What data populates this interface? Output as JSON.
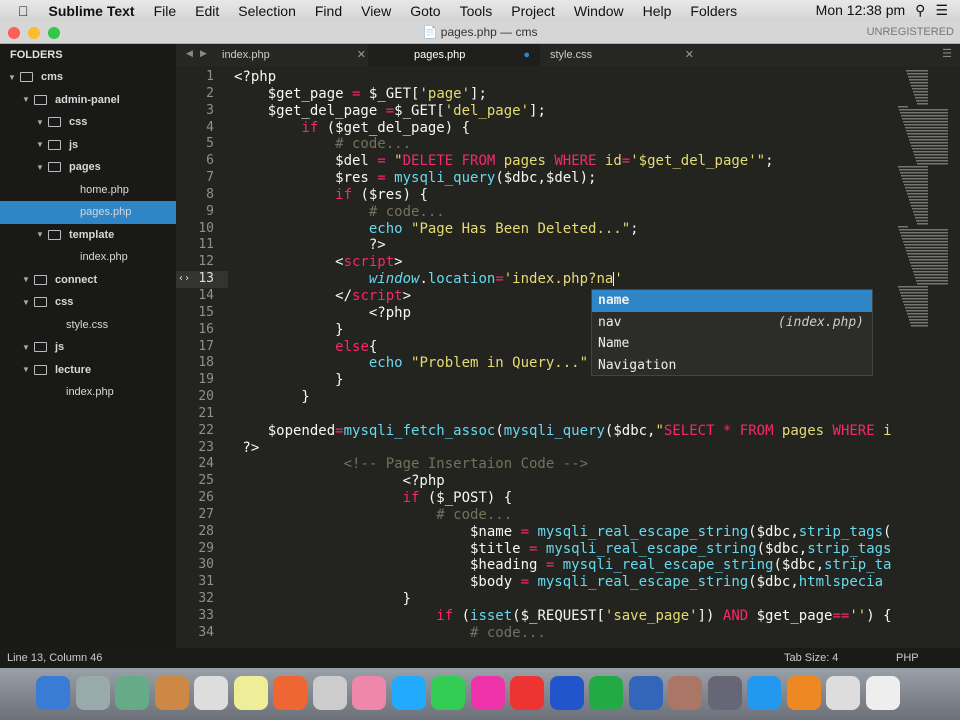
{
  "menubar": {
    "app": "Sublime Text",
    "items": [
      "File",
      "Edit",
      "Selection",
      "Find",
      "View",
      "Goto",
      "Tools",
      "Project",
      "Window",
      "Help",
      "Folders"
    ],
    "clock": "Mon 12:38 pm"
  },
  "window": {
    "title": "pages.php — cms",
    "unregistered": "UNREGISTERED"
  },
  "sidebar": {
    "header": "FOLDERS",
    "items": [
      {
        "label": "cms",
        "type": "folder",
        "depth": 0
      },
      {
        "label": "admin-panel",
        "type": "folder",
        "depth": 1
      },
      {
        "label": "css",
        "type": "folder",
        "depth": 2
      },
      {
        "label": "js",
        "type": "folder",
        "depth": 2
      },
      {
        "label": "pages",
        "type": "folder",
        "depth": 2
      },
      {
        "label": "home.php",
        "type": "file",
        "depth": 3
      },
      {
        "label": "pages.php",
        "type": "file",
        "depth": 3,
        "selected": true
      },
      {
        "label": "template",
        "type": "folder",
        "depth": 2
      },
      {
        "label": "index.php",
        "type": "file",
        "depth": 3
      },
      {
        "label": "connect",
        "type": "folder",
        "depth": 1
      },
      {
        "label": "css",
        "type": "folder",
        "depth": 1
      },
      {
        "label": "style.css",
        "type": "file",
        "depth": 2
      },
      {
        "label": "js",
        "type": "folder",
        "depth": 1
      },
      {
        "label": "lecture",
        "type": "folder",
        "depth": 1
      },
      {
        "label": "index.php",
        "type": "file",
        "depth": 2
      }
    ]
  },
  "tabs": [
    {
      "label": "index.php",
      "active": false
    },
    {
      "label": "pages.php",
      "active": true,
      "dirty": true
    },
    {
      "label": "style.css",
      "active": false
    }
  ],
  "editor": {
    "first_line": 1,
    "current_line": 13,
    "lines": [
      [
        [
          "t",
          "<?php"
        ]
      ],
      [
        [
          "t",
          "    $get_page "
        ],
        [
          "k",
          "="
        ],
        [
          "t",
          " $_GET["
        ],
        [
          "s",
          "'page'"
        ],
        [
          "t",
          "];"
        ]
      ],
      [
        [
          "t",
          "    $get_del_page "
        ],
        [
          "k",
          "="
        ],
        [
          "t",
          "$_GET["
        ],
        [
          "s",
          "'del_page'"
        ],
        [
          "t",
          "];"
        ]
      ],
      [
        [
          "t",
          "        "
        ],
        [
          "k",
          "if"
        ],
        [
          "t",
          " ($get_del_page) {"
        ]
      ],
      [
        [
          "c",
          "            # code..."
        ]
      ],
      [
        [
          "t",
          "            $del "
        ],
        [
          "k",
          "="
        ],
        [
          "t",
          " "
        ],
        [
          "s",
          "\""
        ],
        [
          "k",
          "DELETE FROM"
        ],
        [
          "s",
          " pages "
        ],
        [
          "k",
          "WHERE"
        ],
        [
          "s",
          " id"
        ],
        [
          "k",
          "="
        ],
        [
          "s",
          "'$get_del_page'\""
        ],
        [
          "t",
          ";"
        ]
      ],
      [
        [
          "t",
          "            $res "
        ],
        [
          "k",
          "="
        ],
        [
          "t",
          " "
        ],
        [
          "f",
          "mysqli_query"
        ],
        [
          "t",
          "($dbc,$del);"
        ]
      ],
      [
        [
          "t",
          "            "
        ],
        [
          "k",
          "if"
        ],
        [
          "t",
          " ($res) {"
        ]
      ],
      [
        [
          "c",
          "                # code..."
        ]
      ],
      [
        [
          "t",
          "                "
        ],
        [
          "f",
          "echo"
        ],
        [
          "t",
          " "
        ],
        [
          "s",
          "\"Page Has Been Deleted...\""
        ],
        [
          "t",
          ";"
        ]
      ],
      [
        [
          "t",
          "                ?>"
        ]
      ],
      [
        [
          "t",
          "            <"
        ],
        [
          "k",
          "script"
        ],
        [
          "t",
          ">"
        ]
      ],
      [
        [
          "t",
          "                "
        ],
        [
          "i",
          "window"
        ],
        [
          "t",
          "."
        ],
        [
          "f",
          "location"
        ],
        [
          "k",
          "="
        ],
        [
          "s",
          "'index.php?na"
        ],
        [
          "caret",
          ""
        ],
        [
          "s",
          "'"
        ]
      ],
      [
        [
          "t",
          "            </"
        ],
        [
          "k",
          "script"
        ],
        [
          "t",
          ">"
        ]
      ],
      [
        [
          "t",
          "                <?php"
        ]
      ],
      [
        [
          "t",
          "            }"
        ]
      ],
      [
        [
          "t",
          "            "
        ],
        [
          "k",
          "else"
        ],
        [
          "t",
          "{"
        ]
      ],
      [
        [
          "t",
          "                "
        ],
        [
          "f",
          "echo"
        ],
        [
          "t",
          " "
        ],
        [
          "s",
          "\"Problem in Query...\""
        ]
      ],
      [
        [
          "t",
          "            }"
        ]
      ],
      [
        [
          "t",
          "        }"
        ]
      ],
      [
        [
          "t",
          ""
        ]
      ],
      [
        [
          "t",
          "    $opended"
        ],
        [
          "k",
          "="
        ],
        [
          "f",
          "mysqli_fetch_assoc"
        ],
        [
          "t",
          "("
        ],
        [
          "f",
          "mysqli_query"
        ],
        [
          "t",
          "($dbc,"
        ],
        [
          "s",
          "\""
        ],
        [
          "k",
          "SELECT * FROM"
        ],
        [
          "s",
          " pages "
        ],
        [
          "k",
          "WHERE"
        ],
        [
          "s",
          " i"
        ]
      ],
      [
        [
          "t",
          " ?>"
        ]
      ],
      [
        [
          "c",
          "             <!-- Page Insertaion Code -->"
        ]
      ],
      [
        [
          "t",
          "                    <?php"
        ]
      ],
      [
        [
          "t",
          "                    "
        ],
        [
          "k",
          "if"
        ],
        [
          "t",
          " ($_POST) {"
        ]
      ],
      [
        [
          "c",
          "                        # code..."
        ]
      ],
      [
        [
          "t",
          "                            $name "
        ],
        [
          "k",
          "="
        ],
        [
          "t",
          " "
        ],
        [
          "f",
          "mysqli_real_escape_string"
        ],
        [
          "t",
          "($dbc,"
        ],
        [
          "f",
          "strip_tags"
        ],
        [
          "t",
          "("
        ]
      ],
      [
        [
          "t",
          "                            $title "
        ],
        [
          "k",
          "="
        ],
        [
          "t",
          " "
        ],
        [
          "f",
          "mysqli_real_escape_string"
        ],
        [
          "t",
          "($dbc,"
        ],
        [
          "f",
          "strip_tags"
        ]
      ],
      [
        [
          "t",
          "                            $heading "
        ],
        [
          "k",
          "="
        ],
        [
          "t",
          " "
        ],
        [
          "f",
          "mysqli_real_escape_string"
        ],
        [
          "t",
          "($dbc,"
        ],
        [
          "f",
          "strip_ta"
        ]
      ],
      [
        [
          "t",
          "                            $body "
        ],
        [
          "k",
          "="
        ],
        [
          "t",
          " "
        ],
        [
          "f",
          "mysqli_real_escape_string"
        ],
        [
          "t",
          "($dbc,"
        ],
        [
          "f",
          "htmlspecia"
        ]
      ],
      [
        [
          "t",
          "                    }"
        ]
      ],
      [
        [
          "t",
          "                        "
        ],
        [
          "k",
          "if"
        ],
        [
          "t",
          " ("
        ],
        [
          "f",
          "isset"
        ],
        [
          "t",
          "($_REQUEST["
        ],
        [
          "s",
          "'save_page'"
        ],
        [
          "t",
          "]) "
        ],
        [
          "k",
          "AND"
        ],
        [
          "t",
          " $get_page"
        ],
        [
          "k",
          "=="
        ],
        [
          "s",
          "''"
        ],
        [
          "t",
          ") {"
        ]
      ],
      [
        [
          "c",
          "                            # code..."
        ]
      ]
    ]
  },
  "autocomplete": {
    "items": [
      {
        "label": "name",
        "selected": true
      },
      {
        "label": "nav",
        "hint": "(index.php)"
      },
      {
        "label": "Name"
      },
      {
        "label": "Navigation"
      }
    ]
  },
  "status": {
    "position": "Line 13, Column 46",
    "tab_size": "Tab Size: 4",
    "syntax": "PHP"
  },
  "colors": {
    "accent": "#2f86c7",
    "keyword": "#f92672",
    "string": "#e6db74",
    "function": "#66d9ef",
    "comment": "#75715e"
  }
}
